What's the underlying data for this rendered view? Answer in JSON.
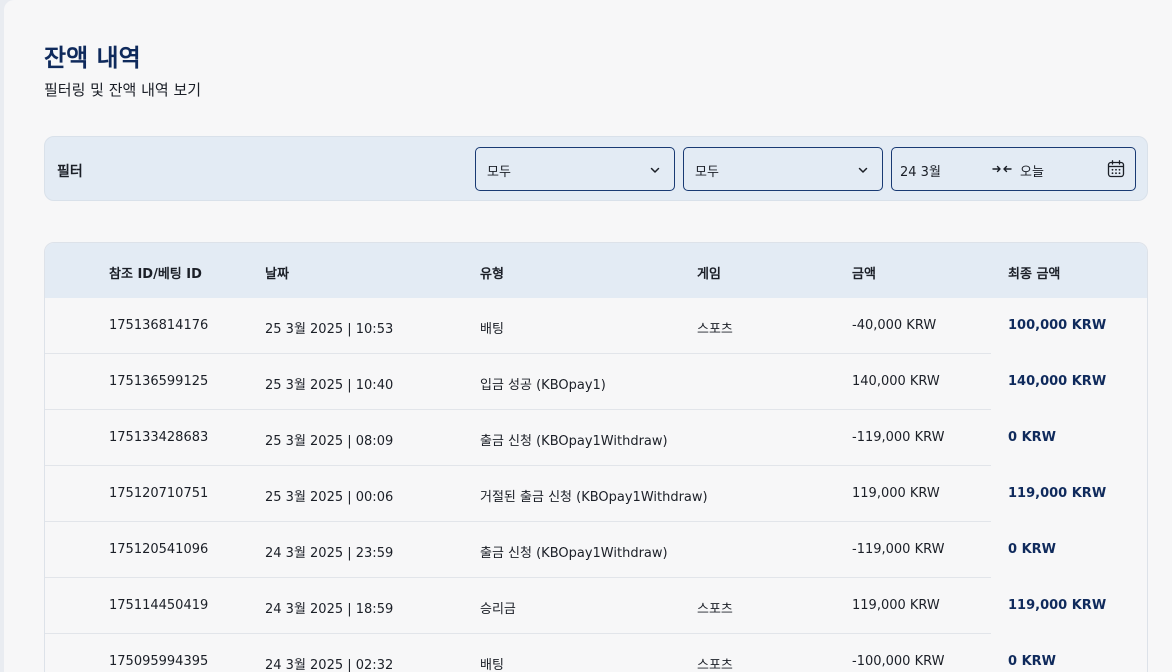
{
  "header": {
    "title": "잔액 내역",
    "subtitle": "필터링 및 잔액 내역 보기"
  },
  "filters": {
    "label": "필터",
    "type_select": "모두",
    "game_select": "모두",
    "date_from": "24 3월",
    "date_to": "오늘"
  },
  "table": {
    "columns": [
      "참조 ID/베팅 ID",
      "날짜",
      "유형",
      "게임",
      "금액",
      "최종 금액"
    ],
    "rows": [
      {
        "ref": "175136814176",
        "date": "25 3월 2025 | 10:53",
        "type": "배팅",
        "game": "스포츠",
        "amount": "-40,000 KRW",
        "final": "100,000 KRW"
      },
      {
        "ref": "175136599125",
        "date": "25 3월 2025 | 10:40",
        "type": "입금 성공 (KBOpay1)",
        "game": "",
        "amount": "140,000 KRW",
        "final": "140,000 KRW"
      },
      {
        "ref": "175133428683",
        "date": "25 3월 2025 | 08:09",
        "type": "출금 신청 (KBOpay1Withdraw)",
        "game": "",
        "amount": "-119,000 KRW",
        "final": "0 KRW"
      },
      {
        "ref": "175120710751",
        "date": "25 3월 2025 | 00:06",
        "type": "거절된 출금 신청 (KBOpay1Withdraw)",
        "game": "",
        "amount": "119,000 KRW",
        "final": "119,000 KRW"
      },
      {
        "ref": "175120541096",
        "date": "24 3월 2025 | 23:59",
        "type": "출금 신청 (KBOpay1Withdraw)",
        "game": "",
        "amount": "-119,000 KRW",
        "final": "0 KRW"
      },
      {
        "ref": "175114450419",
        "date": "24 3월 2025 | 18:59",
        "type": "승리금",
        "game": "스포츠",
        "amount": "119,000 KRW",
        "final": "119,000 KRW"
      },
      {
        "ref": "175095994395",
        "date": "24 3월 2025 | 02:32",
        "type": "배팅",
        "game": "스포츠",
        "amount": "-100,000 KRW",
        "final": "0 KRW"
      }
    ]
  },
  "colors": {
    "accent": "#0f2a5c",
    "filter_bg": "#e3ebf4",
    "select_border": "#193a73"
  },
  "icons": {
    "select_chevron": "chevron-down-icon",
    "date_arrows": "arrows-inward-icon",
    "calendar": "calendar-icon"
  }
}
